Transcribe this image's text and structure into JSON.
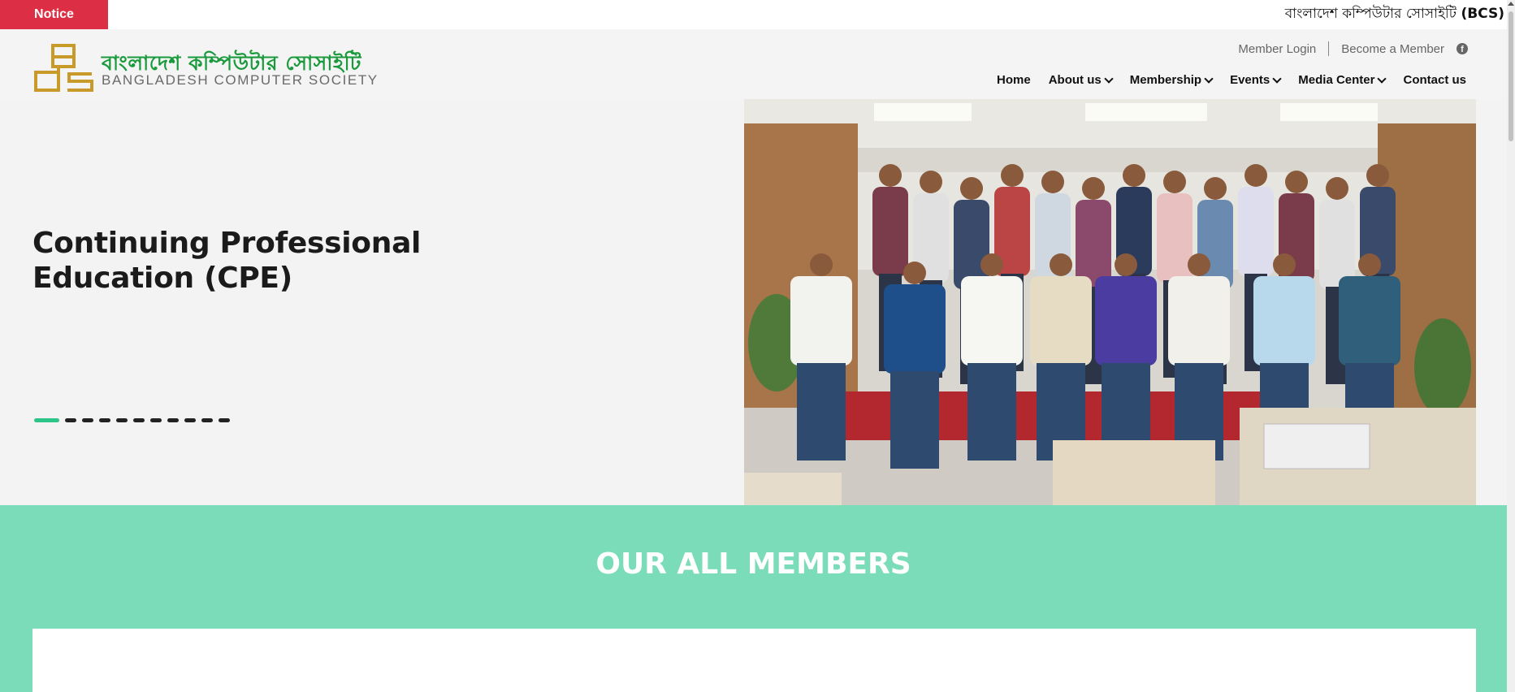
{
  "notice": {
    "tag": "Notice",
    "ticker_text": "বাংলাদেশ কম্পিউটার সোসাইটি ",
    "ticker_bold": "(BCS)"
  },
  "header": {
    "logo_bn": "বাংলাদেশ কম্পিউটার সোসাইটি",
    "logo_en": "BANGLADESH COMPUTER SOCIETY",
    "top_links": {
      "member_login": "Member Login",
      "become_member": "Become a Member",
      "facebook_icon": "facebook-icon"
    },
    "nav": {
      "home": "Home",
      "about": "About us",
      "membership": "Membership",
      "events": "Events",
      "media": "Media Center",
      "contact": "Contact us"
    }
  },
  "hero": {
    "title": "Continuing Professional Education (CPE)",
    "slide_count": 11,
    "active_slide": 1
  },
  "members": {
    "title": "OUR ALL MEMBERS"
  },
  "colors": {
    "notice_red": "#dc2f45",
    "brand_green": "#1a9a3c",
    "brand_gold": "#c89a2a",
    "members_bg": "#7adcb8",
    "slider_active": "#2dc48a"
  }
}
